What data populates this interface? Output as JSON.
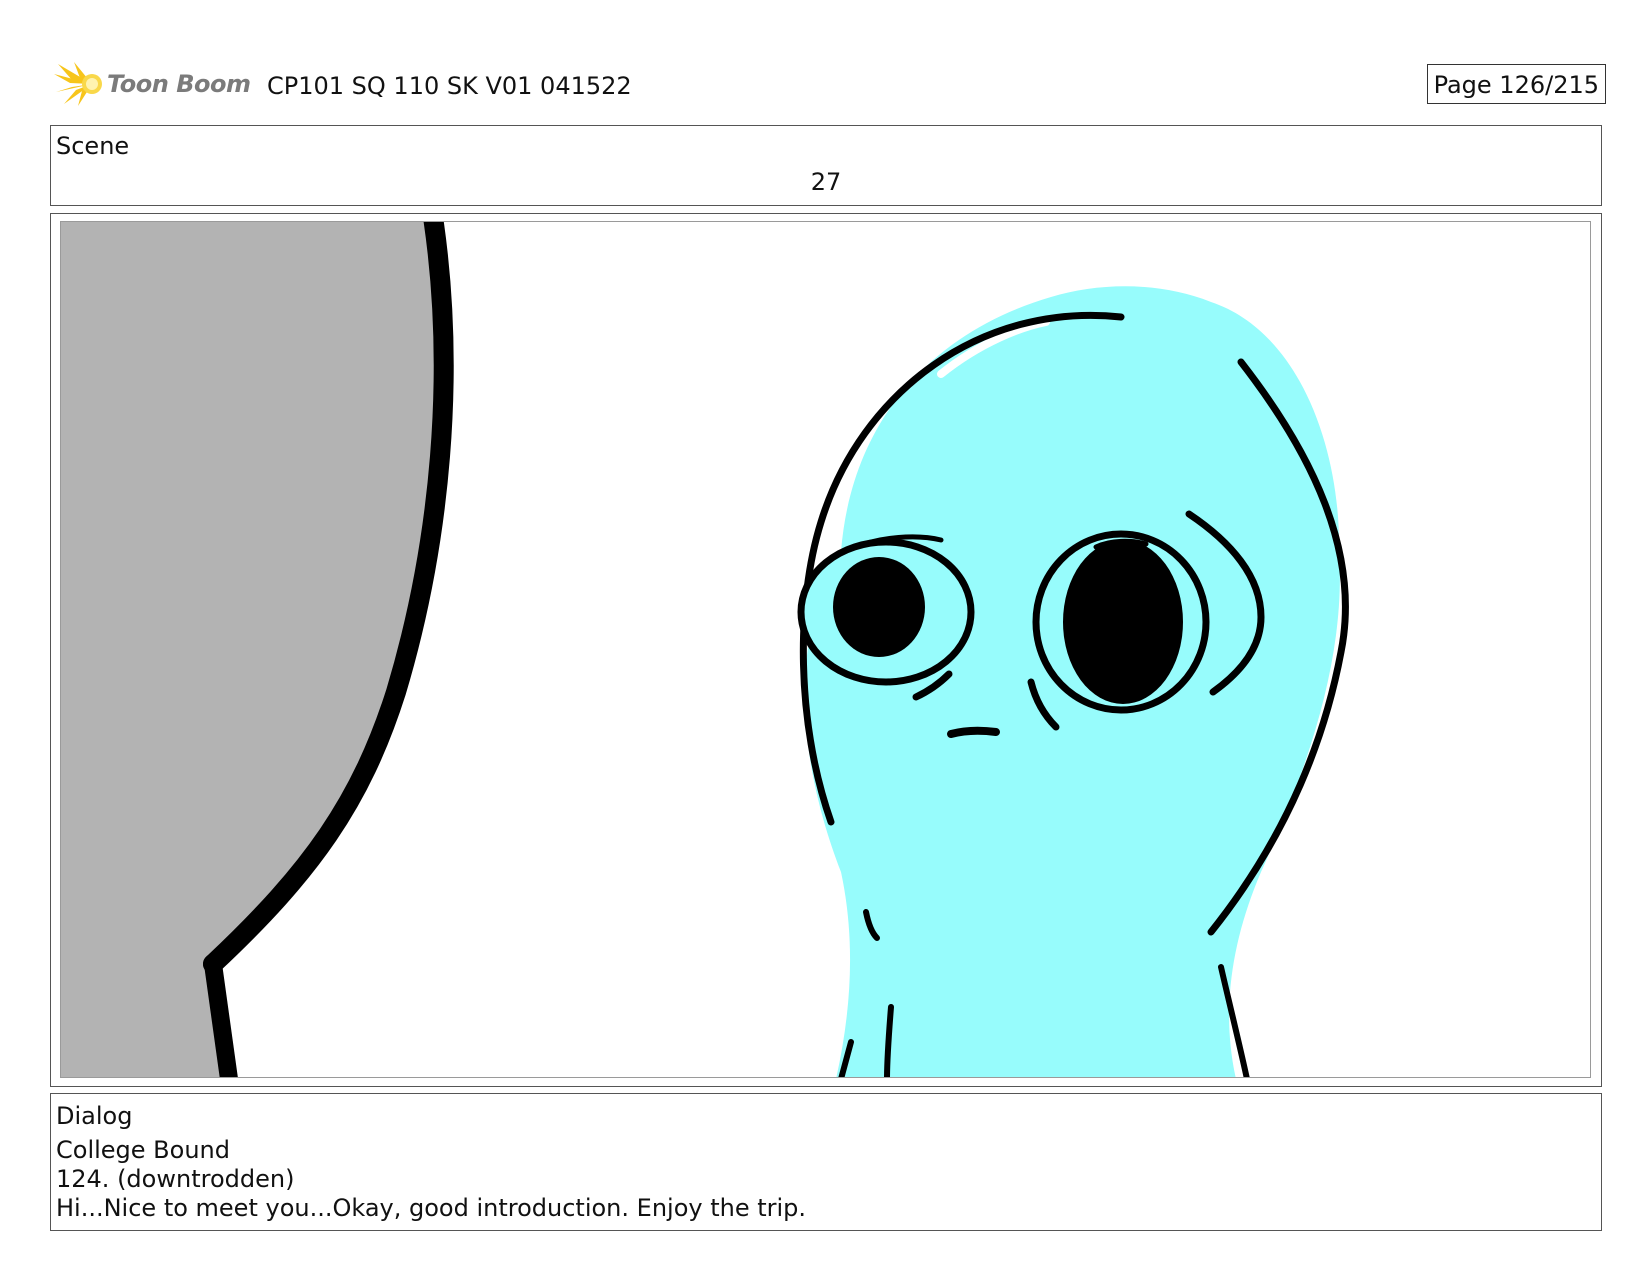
{
  "header": {
    "logo_text": "Toon Boom",
    "title": "CP101 SQ 110 SK V01 041522",
    "page": "Page 126/215"
  },
  "scene": {
    "label": "Scene",
    "number": "27"
  },
  "panel": {
    "colors": {
      "character_fill": "#97fcfc",
      "curtain_fill": "#b3b3b3",
      "line": "#000000",
      "logo_yellow": "#f7c51b"
    }
  },
  "dialog": {
    "label": "Dialog",
    "lines": [
      "College Bound",
      "124. (downtrodden)",
      "Hi...Nice to meet you...Okay, good introduction. Enjoy the trip."
    ]
  }
}
